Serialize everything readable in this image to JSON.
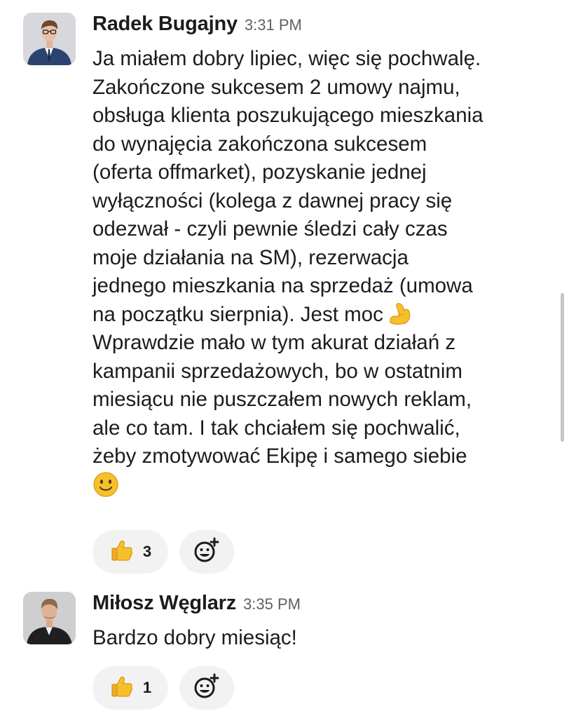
{
  "messages": [
    {
      "author": "Radek Bugajny",
      "time": "3:31 PM",
      "lines": [
        "Ja miałem dobry lipiec, więc się pochwalę.",
        "Zakończone sukcesem 2 umowy najmu,",
        "obsługa klienta poszukującego mieszkania",
        "do wynajęcia zakończona sukcesem",
        "(oferta offmarket), pozyskanie jednej",
        "wyłączności (kolega z dawnej pracy się",
        "odezwał - czyli pewnie śledzi cały czas",
        "moje działania na SM), rezerwacja",
        "jednego mieszkania na sprzedaż (umowa",
        "na początku sierpnia). Jest moc",
        "Wprawdzie mało w tym akurat działań z",
        "kampanii sprzedażowych, bo w ostatnim",
        "miesiącu nie puszczałem nowych reklam,",
        "ale co tam. I tak chciałem się pochwalić,",
        "żeby zmotywować Ekipę i samego siebie"
      ],
      "inline_emoji": [
        "flexed-biceps-emoji",
        "slightly-smiling-face-emoji"
      ],
      "reactions": [
        {
          "emoji": "thumbs-up-emoji",
          "count": "3"
        }
      ]
    },
    {
      "author": "Miłosz Węglarz",
      "time": "3:35 PM",
      "lines": [
        "Bardzo dobry miesiąc!"
      ],
      "reactions": [
        {
          "emoji": "thumbs-up-emoji",
          "count": "1"
        }
      ]
    }
  ],
  "icons": {
    "add_reaction": "add-reaction-icon"
  },
  "colors": {
    "text": "#1d1c1d",
    "timestamp": "#616061",
    "pill_background": "#f2f2f2",
    "emoji_yellow": "#f7c02b"
  }
}
